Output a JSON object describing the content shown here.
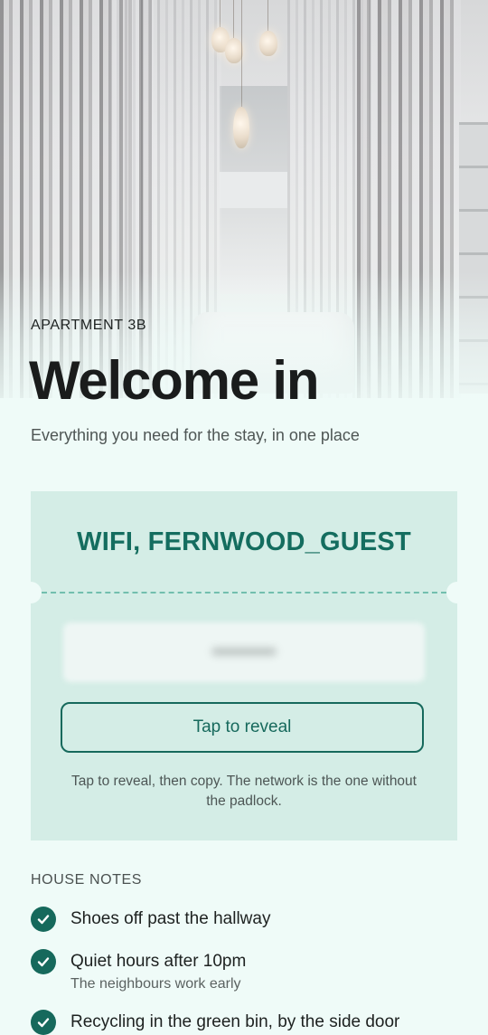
{
  "header": {
    "kicker": "APARTMENT 3B",
    "title": "Welcome in",
    "subtitle": "Everything you need for the stay, in one place"
  },
  "wifi": {
    "network_label": "WIFI, FERNWOOD_GUEST",
    "reveal_button": "Tap to reveal",
    "hint": "Tap to reveal, then copy. The network is the one without the padlock."
  },
  "house_notes": {
    "heading": "HOUSE NOTES",
    "items": [
      {
        "title": "Shoes off past the hallway",
        "subtitle": ""
      },
      {
        "title": "Quiet hours after 10pm",
        "subtitle": "The neighbours work early"
      },
      {
        "title": "Recycling in the green bin, by the side door",
        "subtitle": ""
      }
    ]
  },
  "colors": {
    "accent": "#16695c",
    "card_background": "#d4ede6",
    "page_background": "#effbf8"
  },
  "icons": {
    "note_marker": "check-circle-icon"
  }
}
